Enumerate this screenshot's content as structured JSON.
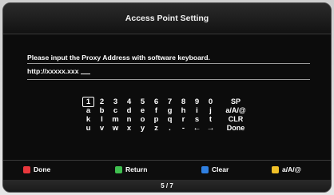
{
  "window": {
    "title": "Access Point Setting"
  },
  "prompt": {
    "text": "Please input the Proxy Address with software keyboard."
  },
  "input": {
    "value": "http://xxxxx.xxx"
  },
  "keyboard": {
    "selected_key": "1",
    "rows": [
      [
        "1",
        "2",
        "3",
        "4",
        "5",
        "6",
        "7",
        "8",
        "9",
        "0",
        "SP"
      ],
      [
        "a",
        "b",
        "c",
        "d",
        "e",
        "f",
        "g",
        "h",
        "i",
        "j",
        "a/A/@"
      ],
      [
        "k",
        "l",
        "m",
        "n",
        "o",
        "p",
        "q",
        "r",
        "s",
        "t",
        "CLR"
      ],
      [
        "u",
        "v",
        "w",
        "x",
        "y",
        "z",
        ".",
        "-",
        "←",
        "→",
        "Done"
      ]
    ]
  },
  "color_buttons": [
    {
      "label": "Done",
      "color": "#e8373c",
      "icon": "red-button-icon"
    },
    {
      "label": "Return",
      "color": "#3fbf4f",
      "icon": "green-button-icon"
    },
    {
      "label": "Clear",
      "color": "#2f7fe0",
      "icon": "blue-button-icon"
    },
    {
      "label": "a/A/@",
      "color": "#f0c028",
      "icon": "yellow-button-icon"
    }
  ],
  "pagination": {
    "text": "5 / 7"
  }
}
